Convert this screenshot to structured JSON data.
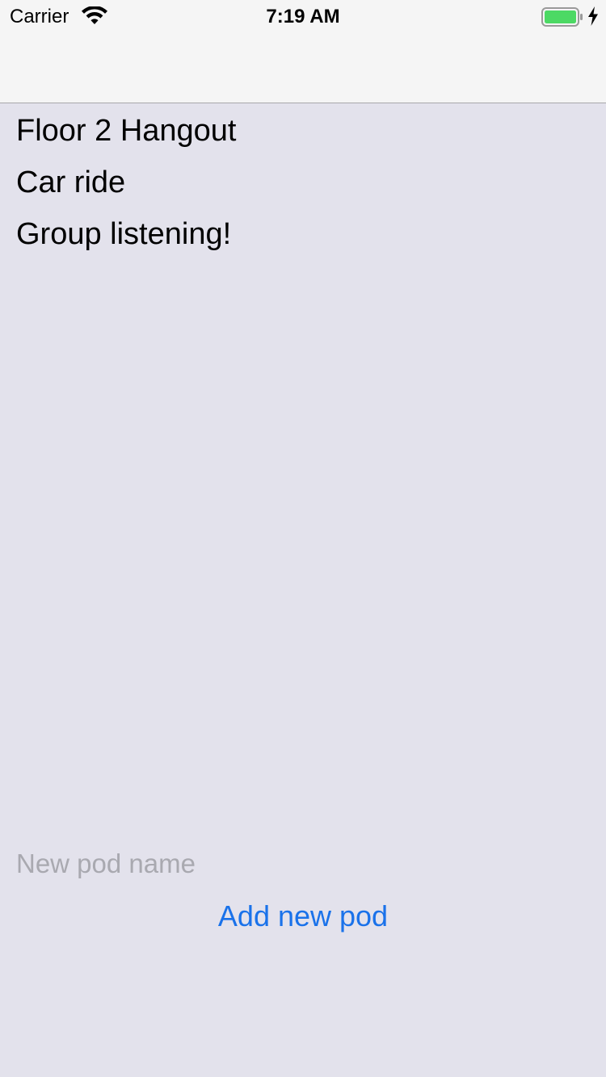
{
  "status_bar": {
    "carrier": "Carrier",
    "time": "7:19 AM",
    "battery_color": "#4cd964"
  },
  "pods": [
    {
      "name": "Floor 2 Hangout"
    },
    {
      "name": "Car ride"
    },
    {
      "name": "Group listening!"
    }
  ],
  "new_pod": {
    "placeholder": "New pod name",
    "value": "",
    "add_label": "Add new pod"
  },
  "colors": {
    "background": "#e3e2ec",
    "accent": "#1a72ea",
    "bar": "#f5f5f5"
  },
  "icons": [
    "wifi-icon",
    "battery-icon",
    "charging-bolt-icon"
  ]
}
